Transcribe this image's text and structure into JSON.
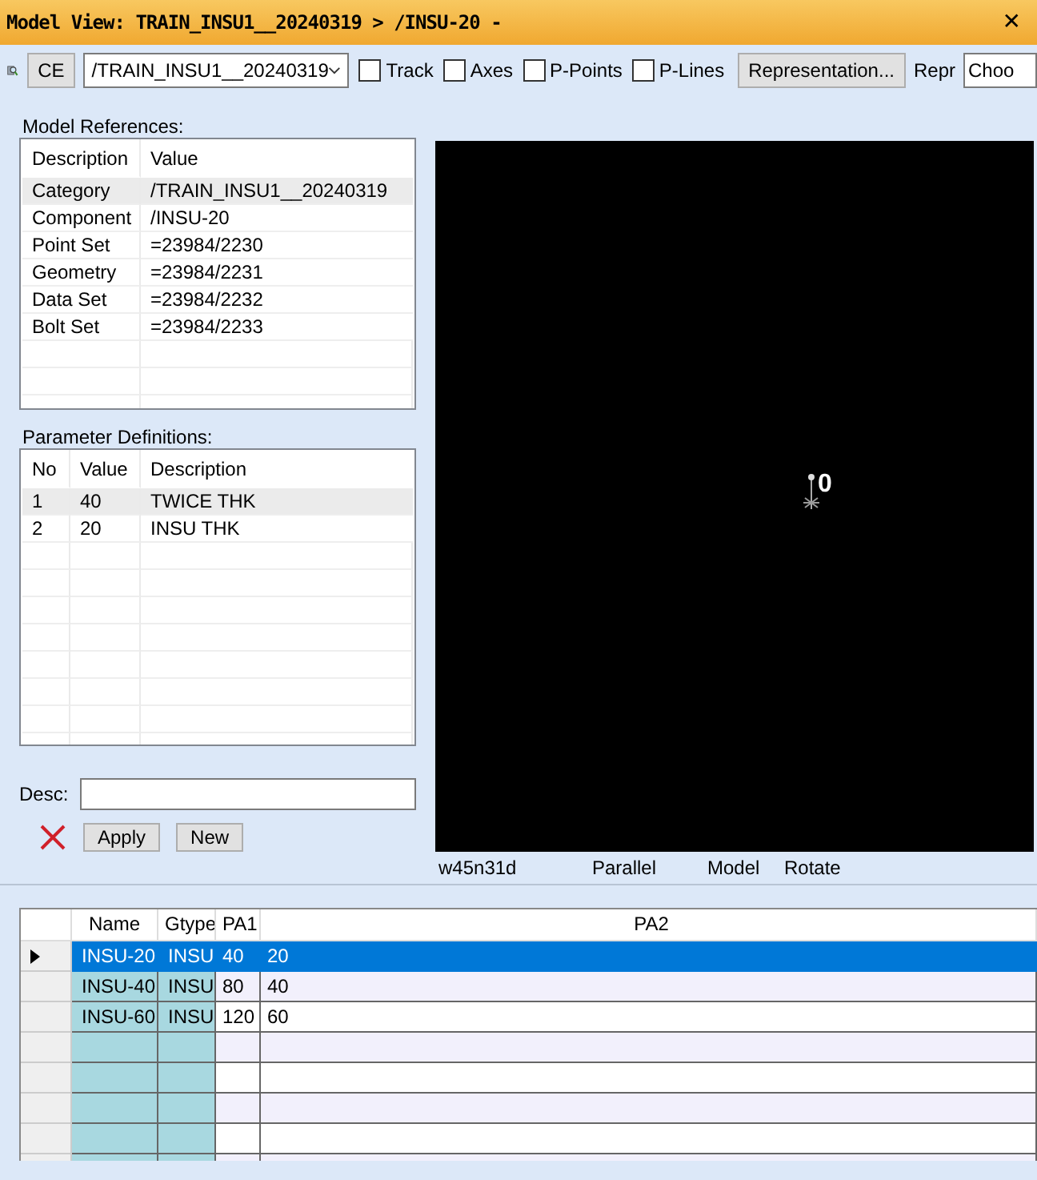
{
  "window": {
    "title": "Model View: TRAIN_INSU1__20240319 > /INSU-20 -",
    "close": "✕"
  },
  "toolbar": {
    "ce_button": "CE",
    "combo": {
      "value": "/TRAIN_INSU1__20240319"
    },
    "checkboxes": [
      {
        "label": "Track",
        "checked": false
      },
      {
        "label": "Axes",
        "checked": false
      },
      {
        "label": "P-Points",
        "checked": false
      },
      {
        "label": "P-Lines",
        "checked": false
      }
    ],
    "representation_button": "Representation...",
    "repr_label": "Repr",
    "repr_field": {
      "value": "Choo"
    }
  },
  "model_references": {
    "label": "Model References:",
    "columns": [
      "Description",
      "Value"
    ],
    "rows": [
      {
        "cells": [
          "Category",
          "/TRAIN_INSU1__20240319"
        ],
        "selected": true
      },
      {
        "cells": [
          "Component",
          "/INSU-20"
        ],
        "selected": false
      },
      {
        "cells": [
          "Point Set",
          "=23984/2230"
        ],
        "selected": false
      },
      {
        "cells": [
          "Geometry",
          "=23984/2231"
        ],
        "selected": false
      },
      {
        "cells": [
          "Data Set",
          "=23984/2232"
        ],
        "selected": false
      },
      {
        "cells": [
          "Bolt Set",
          "=23984/2233"
        ],
        "selected": false
      }
    ]
  },
  "parameter_definitions": {
    "label": "Parameter Definitions:",
    "columns": [
      "No",
      "Value",
      "Description"
    ],
    "rows": [
      {
        "cells": [
          "1",
          "40",
          "TWICE THK"
        ],
        "selected": true
      },
      {
        "cells": [
          "2",
          "20",
          "INSU THK"
        ],
        "selected": false
      }
    ]
  },
  "desc": {
    "label": "Desc:"
  },
  "buttons": [
    "Apply",
    "New"
  ],
  "viewport": {
    "marker_label": "0",
    "status": [
      "w45n31d",
      "Parallel",
      "Model",
      "Rotate"
    ]
  },
  "grid": {
    "columns": [
      "Name",
      "Gtype",
      "PA1",
      "PA2"
    ],
    "rows": [
      {
        "cells": [
          "INSU-20",
          "INSU",
          "40",
          "20"
        ],
        "selected": true
      },
      {
        "cells": [
          "INSU-40",
          "INSU",
          "80",
          "40"
        ],
        "selected": false
      },
      {
        "cells": [
          "INSU-60",
          "INSU",
          "120",
          "60"
        ],
        "selected": false
      }
    ]
  }
}
